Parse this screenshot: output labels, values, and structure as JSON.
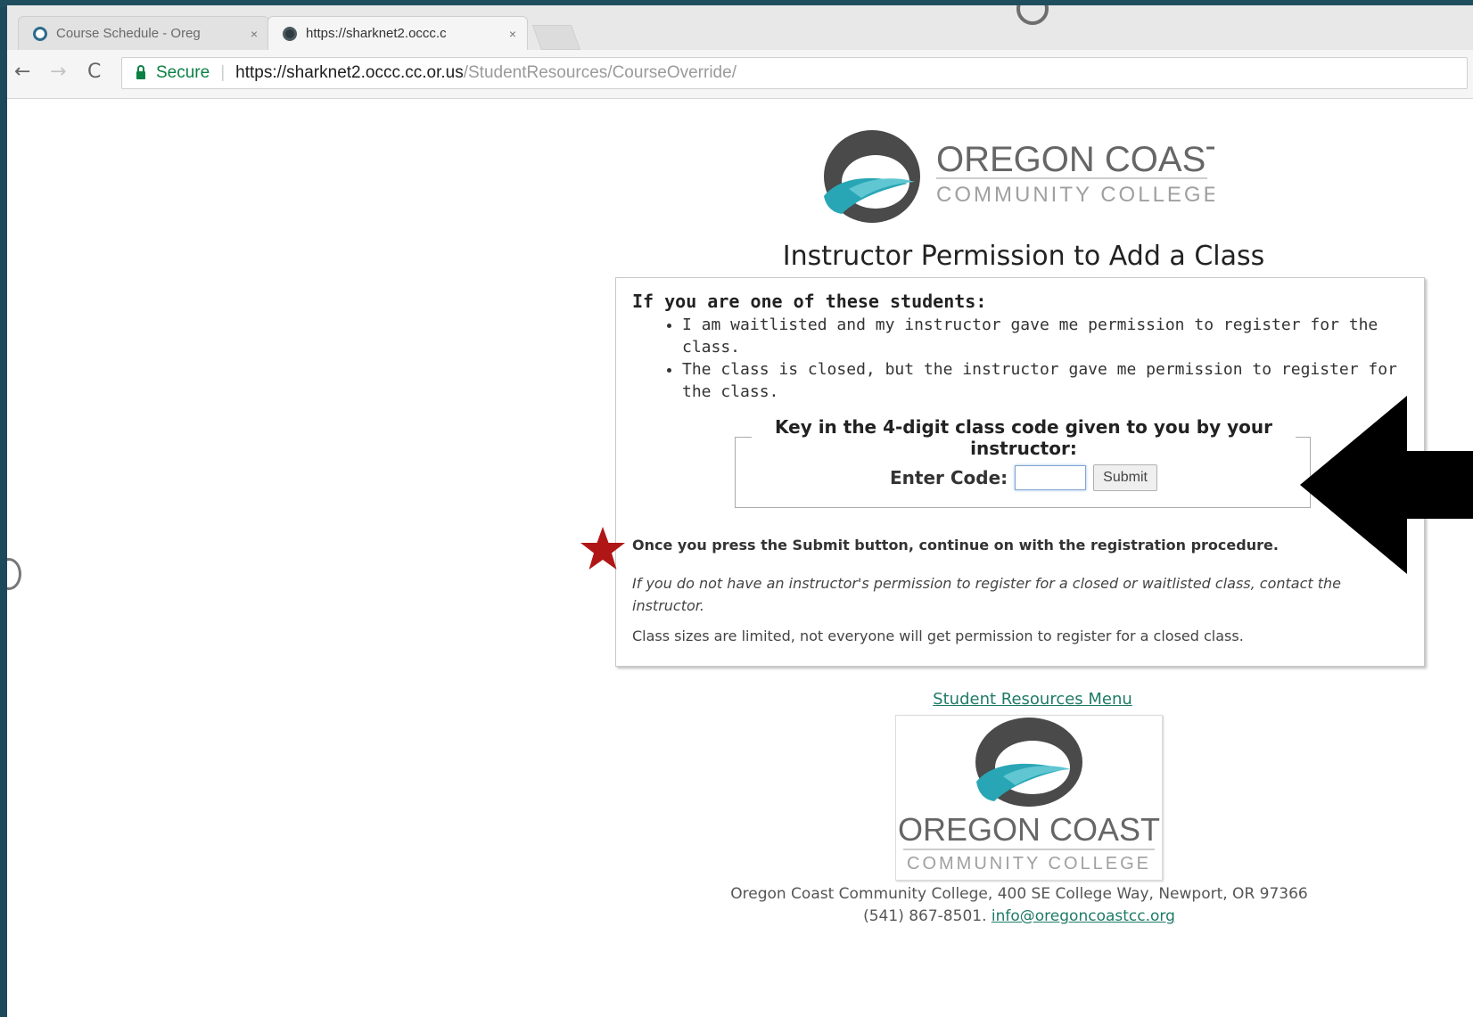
{
  "browser": {
    "tabs": [
      {
        "label": "Course Schedule - Oreg",
        "close": "×"
      },
      {
        "label": "https://sharknet2.occc.c",
        "close": "×"
      }
    ],
    "nav": {
      "back": "←",
      "forward": "→",
      "reload": "C"
    },
    "address": {
      "secure_label": "Secure",
      "separator": "|",
      "url_host": "https://sharknet2.occc.cc.or.us",
      "url_path": "/StudentResources/CourseOverride/"
    }
  },
  "logo": {
    "name_line1": "OREGON COAST",
    "name_line2": "COMMUNITY COLLEGE",
    "colors": {
      "dark": "#4a4a4a",
      "teal": "#29a6b5",
      "grey_text": "#666666",
      "light_text": "#9a9a9a"
    }
  },
  "page": {
    "title": "Instructor Permission to Add a Class",
    "if_heading": "If you are one of these students:",
    "reasons": [
      "I am waitlisted and my instructor gave me permission to register for the class.",
      "The class is closed, but the instructor gave me permission to register for the class."
    ],
    "code_prompt": "Key in the 4-digit class code given to you by your instructor:",
    "enter_code_label": "Enter Code:",
    "code_value": "",
    "submit_label": "Submit",
    "submit_note": "Once you press the Submit button, continue on with the registration procedure.",
    "permission_note": "If you do not have an instructor's permission to register for a closed or waitlisted class, contact the instructor.",
    "class_size_note": "Class sizes are limited, not everyone will get permission to register for a closed class.",
    "student_resources_link": "Student Resources Menu"
  },
  "footer": {
    "address": "Oregon Coast Community College, 400 SE College Way, Newport, OR 97366",
    "phone": "(541) 867-8501.",
    "email": "info@oregoncoastcc.org"
  },
  "annotations": {
    "star_icon": "star-icon",
    "star_color": "#b01616",
    "arrow_icon": "left-arrow-icon",
    "arrow_color": "#000000"
  }
}
